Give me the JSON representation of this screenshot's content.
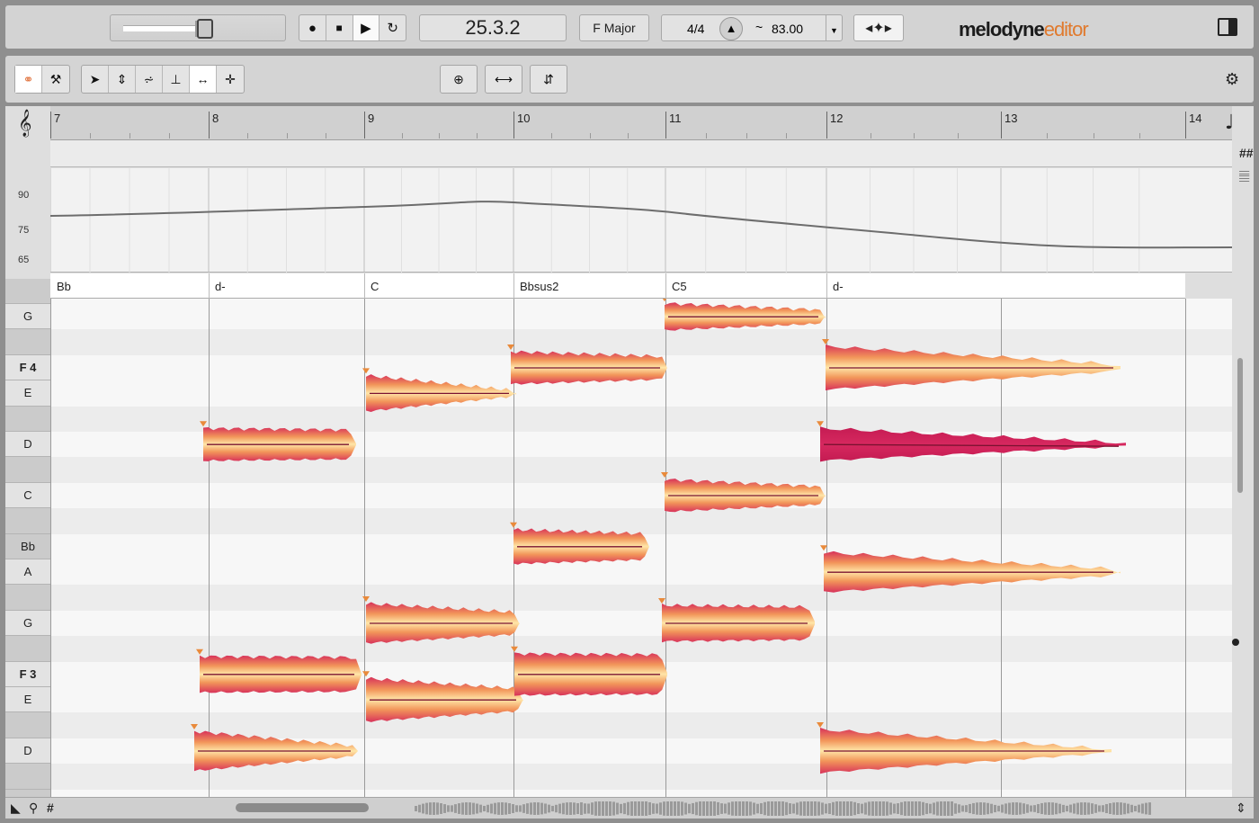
{
  "transport": {
    "record_icon": "●",
    "stop_icon": "■",
    "play_icon": "▶",
    "loop_icon": "↻",
    "position": "25.3.2",
    "key": "F Major",
    "time_signature": "4/4",
    "tempo_prefix": "~",
    "tempo": "83.00"
  },
  "logo": {
    "main": "melodyne",
    "edition": "editor"
  },
  "ruler": {
    "bars": [
      "7",
      "8",
      "9",
      "10",
      "11",
      "12",
      "13",
      "14"
    ]
  },
  "tempo_lane": {
    "labels": [
      "90",
      "75",
      "65"
    ]
  },
  "chords": [
    "Bb",
    "d-",
    "C",
    "Bbsus2",
    "C5",
    "d-"
  ],
  "keys": [
    {
      "label": "G",
      "type": "white"
    },
    {
      "label": "F 4",
      "type": "white",
      "bold": true
    },
    {
      "label": "E",
      "type": "white"
    },
    {
      "label": "D",
      "type": "white"
    },
    {
      "label": "C",
      "type": "white"
    },
    {
      "label": "Bb",
      "type": "black"
    },
    {
      "label": "A",
      "type": "white"
    },
    {
      "label": "G",
      "type": "white"
    },
    {
      "label": "F 3",
      "type": "white",
      "bold": true
    },
    {
      "label": "E",
      "type": "white"
    },
    {
      "label": "D",
      "type": "white"
    }
  ],
  "colors": {
    "blob_outer": "#d8325a",
    "blob_inner": "#ffe6a8",
    "blob_mid": "#f2965a",
    "selected": "#c41b52"
  },
  "icons": {
    "clef": "𝄞",
    "note": "♩",
    "gear": "⚙"
  }
}
